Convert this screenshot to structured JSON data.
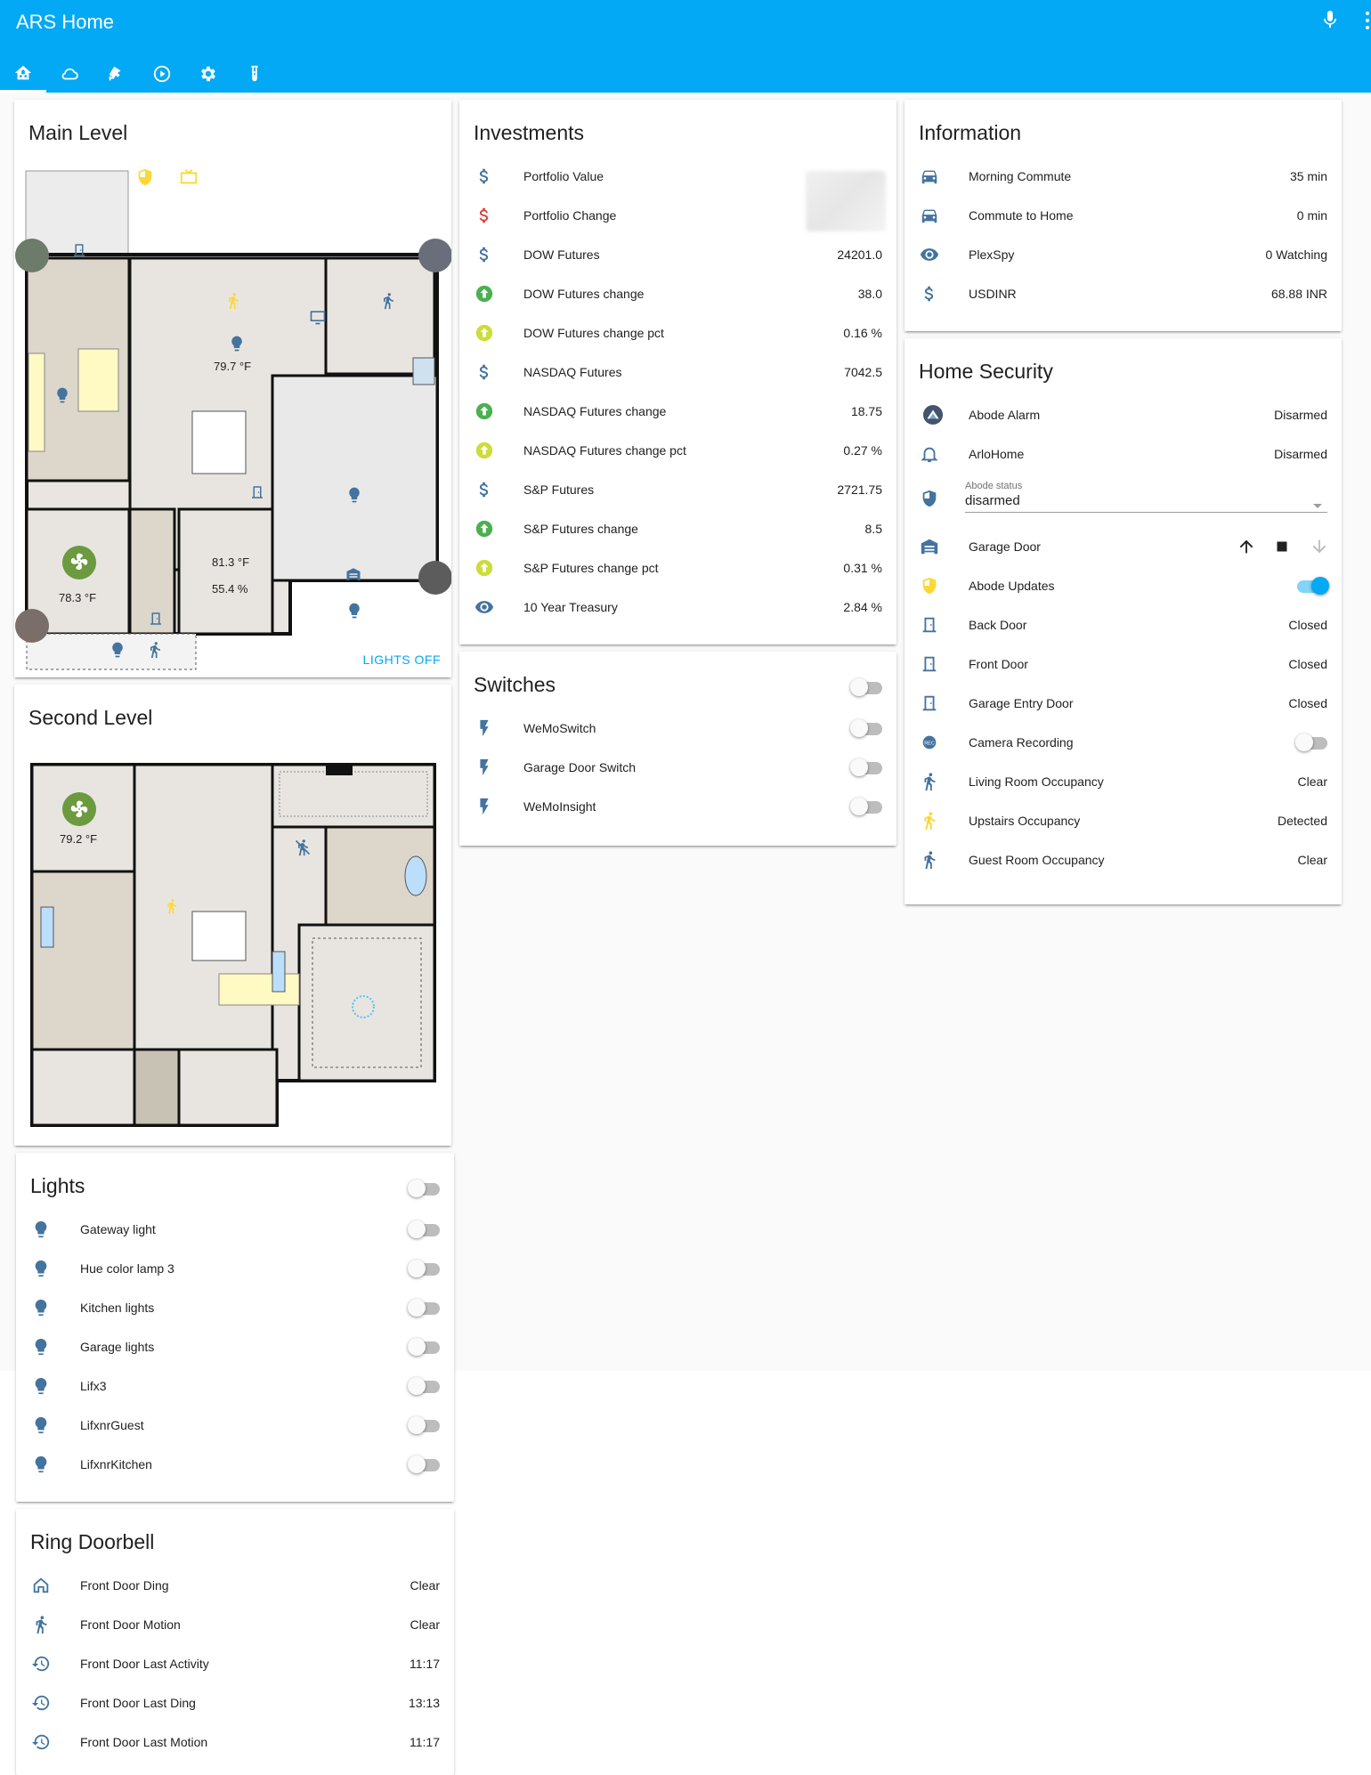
{
  "app": {
    "title": "ARS Home"
  },
  "colors": {
    "primary": "#03a9f4",
    "icon_blue": "#44739e",
    "active_yellow": "#fdd835",
    "green": "#4caf50",
    "red": "#db4437"
  },
  "tabs": [
    {
      "icon": "home-floorplan-icon",
      "active": true
    },
    {
      "icon": "cloud-icon"
    },
    {
      "icon": "cctv-icon"
    },
    {
      "icon": "play-circle-icon"
    },
    {
      "icon": "gear-icon"
    },
    {
      "icon": "test-tube-icon"
    }
  ],
  "main_level": {
    "title": "Main Level",
    "temps": {
      "living": "79.7 °F",
      "garage_temp": "78.3 °F",
      "office_temp": "81.3 °F",
      "office_hum": "55.4 %"
    },
    "action": "LIGHTS OFF"
  },
  "second_level": {
    "title": "Second Level",
    "temp": "79.2 °F"
  },
  "lights": {
    "title": "Lights",
    "items": [
      {
        "label": "Gateway light"
      },
      {
        "label": "Hue color lamp 3"
      },
      {
        "label": "Kitchen lights"
      },
      {
        "label": "Garage lights"
      },
      {
        "label": "Lifx3"
      },
      {
        "label": "LifxnrGuest"
      },
      {
        "label": "LifxnrKitchen"
      }
    ]
  },
  "ring": {
    "title": "Ring Doorbell",
    "items": [
      {
        "label": "Front Door Ding",
        "value": "Clear",
        "icon": "home-outline-icon"
      },
      {
        "label": "Front Door Motion",
        "value": "Clear",
        "icon": "walk-icon"
      },
      {
        "label": "Front Door Last Activity",
        "value": "11:17",
        "icon": "history-icon"
      },
      {
        "label": "Front Door Last Ding",
        "value": "13:13",
        "icon": "history-icon"
      },
      {
        "label": "Front Door Last Motion",
        "value": "11:17",
        "icon": "history-icon"
      }
    ]
  },
  "investments": {
    "title": "Investments",
    "items": [
      {
        "label": "Portfolio Value",
        "value": "",
        "icon": "dollar-icon"
      },
      {
        "label": "Portfolio Change",
        "value": "",
        "icon": "dollar-red-icon"
      },
      {
        "label": "DOW Futures",
        "value": "24201.0",
        "icon": "dollar-icon"
      },
      {
        "label": "DOW Futures change",
        "value": "38.0",
        "icon": "arrow-up-green-icon"
      },
      {
        "label": "DOW Futures change pct",
        "value": "0.16 %",
        "icon": "arrow-up-lime-icon"
      },
      {
        "label": "NASDAQ Futures",
        "value": "7042.5",
        "icon": "dollar-icon"
      },
      {
        "label": "NASDAQ Futures change",
        "value": "18.75",
        "icon": "arrow-up-green-icon"
      },
      {
        "label": "NASDAQ Futures change pct",
        "value": "0.27 %",
        "icon": "arrow-up-lime-icon"
      },
      {
        "label": "S&P Futures",
        "value": "2721.75",
        "icon": "dollar-icon"
      },
      {
        "label": "S&P Futures change",
        "value": "8.5",
        "icon": "arrow-up-green-icon"
      },
      {
        "label": "S&P Futures change pct",
        "value": "0.31 %",
        "icon": "arrow-up-lime-icon"
      },
      {
        "label": "10 Year Treasury",
        "value": "2.84 %",
        "icon": "eye-icon"
      }
    ]
  },
  "switches": {
    "title": "Switches",
    "items": [
      {
        "label": "WeMoSwitch"
      },
      {
        "label": "Garage Door Switch"
      },
      {
        "label": "WeMoInsight"
      }
    ]
  },
  "information": {
    "title": "Information",
    "items": [
      {
        "label": "Morning Commute",
        "value": "35 min",
        "icon": "car-icon"
      },
      {
        "label": "Commute to Home",
        "value": "0 min",
        "icon": "car-icon"
      },
      {
        "label": "PlexSpy",
        "value": "0 Watching",
        "icon": "eye-icon"
      },
      {
        "label": "USDINR",
        "value": "68.88 INR",
        "icon": "dollar-icon"
      }
    ]
  },
  "security": {
    "title": "Home Security",
    "abode_alarm": {
      "label": "Abode Alarm",
      "value": "Disarmed"
    },
    "arlo": {
      "label": "ArloHome",
      "value": "Disarmed"
    },
    "abode_status": {
      "caption": "Abode status",
      "value": "disarmed"
    },
    "garage_door": {
      "label": "Garage Door"
    },
    "abode_updates": {
      "label": "Abode Updates",
      "on": true
    },
    "back_door": {
      "label": "Back Door",
      "value": "Closed"
    },
    "front_door": {
      "label": "Front Door",
      "value": "Closed"
    },
    "garage_entry": {
      "label": "Garage Entry Door",
      "value": "Closed"
    },
    "camera_recording": {
      "label": "Camera Recording",
      "on": false
    },
    "living_occ": {
      "label": "Living Room Occupancy",
      "value": "Clear"
    },
    "upstairs_occ": {
      "label": "Upstairs Occupancy",
      "value": "Detected"
    },
    "guest_occ": {
      "label": "Guest Room Occupancy",
      "value": "Clear"
    }
  }
}
